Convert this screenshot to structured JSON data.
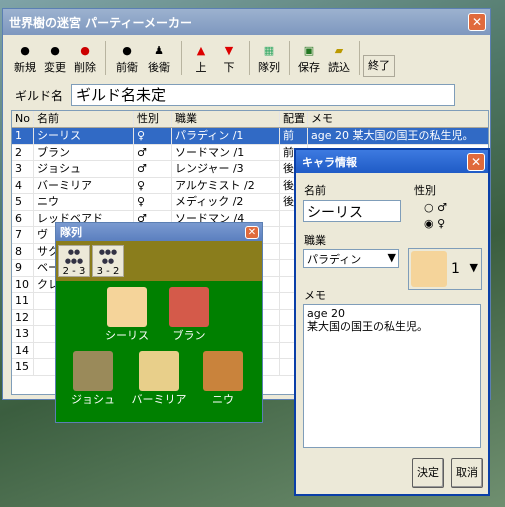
{
  "window": {
    "title": "世界樹の迷宮 パーティーメーカー"
  },
  "toolbar": {
    "new": "新規",
    "change": "変更",
    "delete": "削除",
    "front": "前衛",
    "back": "後衛",
    "up": "上",
    "down": "下",
    "formation": "隊列",
    "save": "保存",
    "load": "読込",
    "exit": "終了"
  },
  "guild": {
    "label": "ギルド名",
    "value": "ギルド名未定"
  },
  "table": {
    "headers": {
      "no": "No",
      "name": "名前",
      "sex": "性別",
      "job": "職業",
      "pos": "配置",
      "memo": "メモ"
    },
    "rows": [
      {
        "no": "1",
        "name": "シーリス",
        "sex": "♀",
        "job": "パラディン /1",
        "pos": "前",
        "memo": "age 20 某大国の国王の私生児。"
      },
      {
        "no": "2",
        "name": "ブラン",
        "sex": "♂",
        "job": "ソードマン /1",
        "pos": "前",
        "memo": ""
      },
      {
        "no": "3",
        "name": "ジョシュ",
        "sex": "♂",
        "job": "レンジャー /3",
        "pos": "後",
        "memo": ""
      },
      {
        "no": "4",
        "name": "バーミリア",
        "sex": "♀",
        "job": "アルケミスト /2",
        "pos": "後",
        "memo": ""
      },
      {
        "no": "5",
        "name": "ニウ",
        "sex": "♀",
        "job": "メディック /2",
        "pos": "後",
        "memo": ""
      },
      {
        "no": "6",
        "name": "レッドベアド",
        "sex": "♂",
        "job": "ソードマン /4",
        "pos": "",
        "memo": ""
      },
      {
        "no": "7",
        "name": "ヴ",
        "sex": "",
        "job": "",
        "pos": "",
        "memo": ""
      },
      {
        "no": "8",
        "name": "サク",
        "sex": "",
        "job": "",
        "pos": "",
        "memo": ""
      },
      {
        "no": "9",
        "name": "ベー",
        "sex": "",
        "job": "",
        "pos": "",
        "memo": ""
      },
      {
        "no": "10",
        "name": "クレ",
        "sex": "",
        "job": "",
        "pos": "",
        "memo": ""
      },
      {
        "no": "11",
        "name": "",
        "sex": "",
        "job": "",
        "pos": "",
        "memo": ""
      },
      {
        "no": "12",
        "name": "",
        "sex": "",
        "job": "",
        "pos": "",
        "memo": ""
      },
      {
        "no": "13",
        "name": "",
        "sex": "",
        "job": "",
        "pos": "",
        "memo": ""
      },
      {
        "no": "14",
        "name": "",
        "sex": "",
        "job": "",
        "pos": "",
        "memo": ""
      },
      {
        "no": "15",
        "name": "",
        "sex": "",
        "job": "",
        "pos": "",
        "memo": ""
      }
    ]
  },
  "formation": {
    "title": "隊列",
    "btn1": "2 - 3",
    "btn2": "3 - 2",
    "front": [
      "シーリス",
      "ブラン"
    ],
    "back": [
      "ジョシュ",
      "バーミリア",
      "ニウ"
    ]
  },
  "info": {
    "title": "キャラ情報",
    "name_label": "名前",
    "name_value": "シーリス",
    "sex_label": "性別",
    "male": "♂",
    "female": "♀",
    "job_label": "職業",
    "job_value": "パラディン",
    "portrait_no": "1",
    "memo_label": "メモ",
    "memo_line1": "age 20",
    "memo_line2": "某大国の国王の私生児。",
    "ok": "決定",
    "cancel": "取消"
  }
}
